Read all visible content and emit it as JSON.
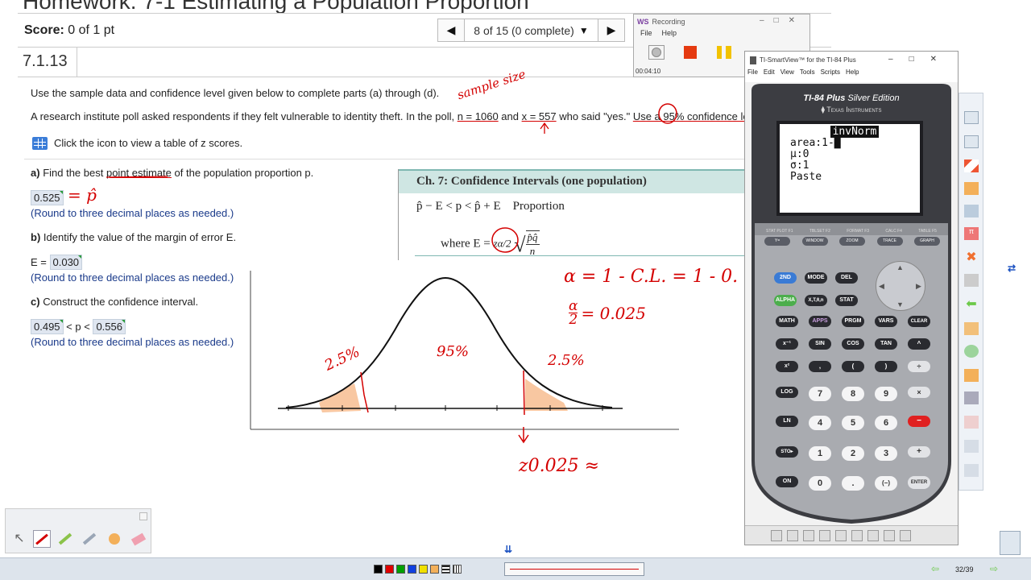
{
  "homework": {
    "title": "Homework: 7-1 Estimating a Population Proportion",
    "score_label": "Score:",
    "score_value": "0 of 1 pt",
    "nav": {
      "prev": "◀",
      "progress": "8 of 15 (0 complete)",
      "caret": "▼",
      "next": "▶"
    },
    "question_number": "7.1.13",
    "instructions": "Use the sample data and confidence level given below to complete parts (a) through (d).",
    "problem": {
      "before": "A research institute poll asked respondents if they felt vulnerable to identity theft. In the poll, ",
      "n": "n = 1060",
      "mid": " and ",
      "x": "x = 557",
      "after": " who said \"yes.\" ",
      "cl": "Use a 95% confidence le"
    },
    "table_link": "Click the icon to view a table of z scores.",
    "part_a": {
      "label": "a)",
      "text_pre": "Find the best ",
      "text_ul": "point estimate",
      "text_post": " of the population proportion p.",
      "answer": "0.525",
      "note": "(Round to three decimal places as needed.)"
    },
    "part_b": {
      "label": "b)",
      "text": "Identify the value of the margin of error E.",
      "prefix": "E =",
      "answer": "0.030",
      "note": "(Round to three decimal places as needed.)"
    },
    "part_c": {
      "label": "c)",
      "text": "Construct the confidence interval.",
      "lower": "0.495",
      "middle": "< p <",
      "upper": "0.556",
      "note": "(Round to three decimal places as needed.)"
    }
  },
  "formula_card": {
    "title": "Ch. 7: Confidence Intervals (one population)",
    "line1": "p̂ − E < p < p̂ + E",
    "line1_label": "Proportion",
    "line2_prefix": "where E =",
    "z_symbol": "zα/2",
    "frac_num": "p̂q̂",
    "frac_den": "n"
  },
  "handwriting": {
    "sample_size": "sample size",
    "p_hat": "= p̂",
    "alpha_line": "α = 1 - C.L. = 1 - 0.",
    "alpha_half_value": "= 0.025",
    "pct_left": "2.5%",
    "pct_center": "95%",
    "pct_right": "2.5%",
    "z_label": "z0.025 ≈"
  },
  "recording": {
    "app_logo": "WS",
    "title": "Recording",
    "menu": [
      "File",
      "Help"
    ],
    "time": "00:04:10"
  },
  "ti_window": {
    "title": "TI-SmartView™ for the TI-84 Plus",
    "menu": [
      "File",
      "Edit",
      "View",
      "Tools",
      "Scripts",
      "Help"
    ],
    "model": "TI-84 Plus",
    "edition": "Silver Edition",
    "brand": "Texas Instruments",
    "screen": {
      "header": "invNorm",
      "lines": [
        "area:1-█",
        "μ:0",
        "σ:1",
        "Paste"
      ]
    },
    "keys": {
      "func_row": [
        "Y=",
        "WINDOW",
        "ZOOM",
        "TRACE",
        "GRAPH"
      ],
      "func_top": [
        "STAT PLOT F1",
        "TBLSET F2",
        "FORMAT F3",
        "CALC F4",
        "TABLE F5"
      ],
      "row1": [
        "2ND",
        "MODE",
        "DEL"
      ],
      "row2": [
        "ALPHA",
        "X,T,θ,n",
        "STAT"
      ],
      "row3": [
        "MATH",
        "APPS",
        "PRGM",
        "VARS",
        "CLEAR"
      ],
      "row4": [
        "x⁻¹",
        "SIN",
        "COS",
        "TAN",
        "^"
      ],
      "row5": [
        "x²",
        ",",
        "(",
        ")",
        "÷"
      ],
      "row6": [
        "LOG",
        "7",
        "8",
        "9",
        "×"
      ],
      "row7": [
        "LN",
        "4",
        "5",
        "6",
        "−"
      ],
      "row8": [
        "STO▸",
        "1",
        "2",
        "3",
        "+"
      ],
      "row9": [
        "ON",
        "0",
        ".",
        "(−)",
        "ENTER"
      ]
    }
  },
  "bottombar": {
    "page": "32/39",
    "down_arrows": "⇊"
  },
  "colors": {
    "accent_blue": "#1a3a8a",
    "ink_red": "#d40000",
    "highlight_orange": "#f6b98a",
    "teal_head": "#cfe6e3"
  }
}
